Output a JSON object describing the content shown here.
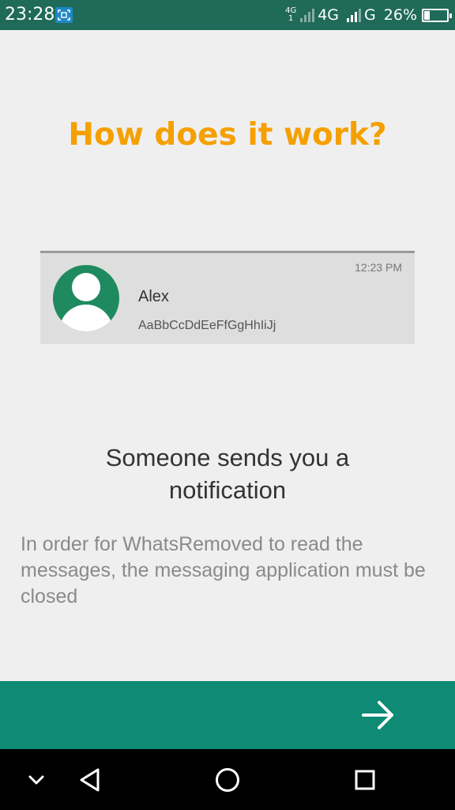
{
  "status_bar": {
    "time": "23:28",
    "network_small_top": "4G",
    "network_small_bottom": "1",
    "network_primary": "4G",
    "network_secondary": "G",
    "battery_percent": "26%",
    "battery_level": 0.26
  },
  "screen": {
    "heading": "How does it work?",
    "subtitle": "Someone sends you a notification",
    "description": "In order for WhatsRemoved to read the messages, the messaging application must be closed"
  },
  "notification": {
    "time": "12:23 PM",
    "name": "Alex",
    "text": "AaBbCcDdEeFfGgHhIiJj"
  },
  "icons": {
    "next": "arrow-right-icon",
    "nav_down": "chevron-down-icon",
    "nav_back": "back-triangle-icon",
    "nav_home": "home-circle-icon",
    "nav_recent": "recent-square-icon"
  },
  "colors": {
    "status_bar": "#1f6a58",
    "heading": "#f5a000",
    "action_bar": "#0e8a75",
    "avatar": "#1f8a5f"
  }
}
